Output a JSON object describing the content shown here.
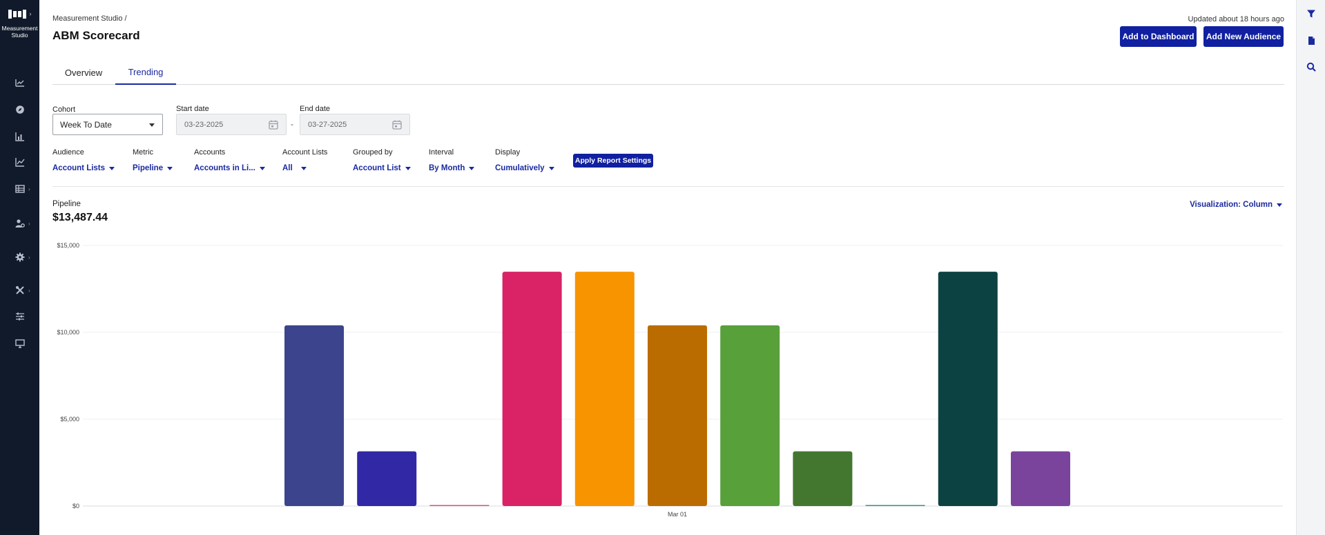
{
  "app": {
    "logo_text": "Measurement Studio"
  },
  "leftnav": {
    "items": [
      {
        "icon": "trend-icon",
        "has_submenu": false
      },
      {
        "icon": "compass-icon",
        "has_submenu": false
      },
      {
        "icon": "bar-chart-icon",
        "has_submenu": false
      },
      {
        "icon": "line-chart-icon",
        "has_submenu": false
      },
      {
        "icon": "table-icon",
        "has_submenu": true
      },
      {
        "icon": "users-settings-icon",
        "has_submenu": true
      },
      {
        "icon": "gear-icon",
        "has_submenu": true
      },
      {
        "icon": "tools-icon",
        "has_submenu": true
      },
      {
        "icon": "sliders-icon",
        "has_submenu": false
      },
      {
        "icon": "monitor-icon",
        "has_submenu": false
      }
    ]
  },
  "rightrail": {
    "icons": [
      "filter-icon",
      "document-icon",
      "search-icon"
    ]
  },
  "header": {
    "breadcrumb": "Measurement Studio /",
    "title": "ABM Scorecard",
    "updated": "Updated about 18 hours ago",
    "add_dashboard_label": "Add to Dashboard",
    "add_audience_label": "Add New Audience"
  },
  "tabs": [
    {
      "label": "Overview",
      "active": false
    },
    {
      "label": "Trending",
      "active": true
    }
  ],
  "filters": {
    "cohort": {
      "label": "Cohort",
      "value": "Week To Date"
    },
    "start_date": {
      "label": "Start date",
      "value": "03-23-2025"
    },
    "separator": "-",
    "end_date": {
      "label": "End date",
      "value": "03-27-2025"
    },
    "audience": {
      "label": "Audience",
      "value": "Account Lists"
    },
    "metric": {
      "label": "Metric",
      "value": "Pipeline"
    },
    "accounts": {
      "label": "Accounts",
      "value": "Accounts in Li..."
    },
    "account_lists": {
      "label": "Account Lists",
      "value": "All"
    },
    "grouped_by": {
      "label": "Grouped by",
      "value": "Account List"
    },
    "interval": {
      "label": "Interval",
      "value": "By Month"
    },
    "display": {
      "label": "Display",
      "value": "Cumulatively"
    },
    "apply_label": "Apply Report Settings"
  },
  "report": {
    "metric_name": "Pipeline",
    "metric_value": "$13,487.44",
    "visualization_label": "Visualization: Column"
  },
  "chart_data": {
    "type": "bar",
    "categories": [
      "Mar 01"
    ],
    "ylim": [
      0,
      15000
    ],
    "yticks": [
      0,
      5000,
      10000,
      15000
    ],
    "ytick_labels": [
      "$0",
      "$5,000",
      "$10,000",
      "$15,000"
    ],
    "grid": true,
    "series": [
      {
        "values": [
          10400
        ],
        "color": "#3b448c"
      },
      {
        "values": [
          3150
        ],
        "color": "#3028a5"
      },
      {
        "values": [
          30
        ],
        "color": "#e0507a"
      },
      {
        "values": [
          13487
        ],
        "color": "#d92366"
      },
      {
        "values": [
          13487
        ],
        "color": "#f79400"
      },
      {
        "values": [
          10400
        ],
        "color": "#bb6c00"
      },
      {
        "values": [
          10400
        ],
        "color": "#58a03a"
      },
      {
        "values": [
          3150
        ],
        "color": "#437730"
      },
      {
        "values": [
          30
        ],
        "color": "#2a9a8a"
      },
      {
        "values": [
          13487
        ],
        "color": "#0d4242"
      },
      {
        "values": [
          3150
        ],
        "color": "#7a449c"
      }
    ]
  }
}
